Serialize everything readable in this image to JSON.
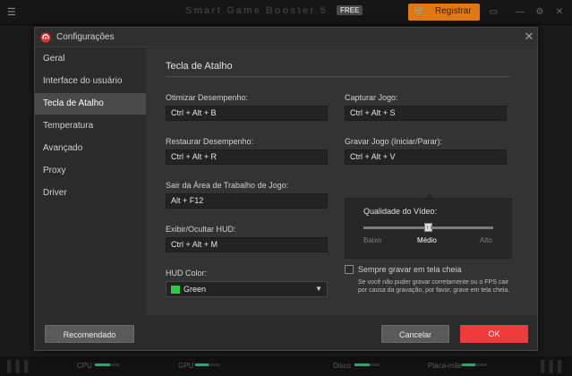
{
  "app": {
    "title": "Smart Game Booster 5",
    "free_badge": "FREE",
    "register_label": "Registrar"
  },
  "status_bar": {
    "cpu_label": "CPU",
    "gpu_label": "GPU",
    "disk_label": "Disco",
    "motherboard_label": "Placa-mãe"
  },
  "dialog": {
    "title": "Configurações",
    "close_glyph": "✕"
  },
  "sidebar": {
    "items": [
      {
        "label": "Geral"
      },
      {
        "label": "Interface do usuário"
      },
      {
        "label": "Tecla de Atalho"
      },
      {
        "label": "Temperatura"
      },
      {
        "label": "Avançado"
      },
      {
        "label": "Proxy"
      },
      {
        "label": "Driver"
      }
    ],
    "active_index": 2
  },
  "hotkeys": {
    "section_title": "Tecla de Atalho",
    "optimize": {
      "label": "Otimizar Desempenho:",
      "value": "Ctrl + Alt + B"
    },
    "restore": {
      "label": "Restaurar Desempenho:",
      "value": "Ctrl + Alt + R"
    },
    "exit_workspace": {
      "label": "Sair da Área de Trabalho de Jogo:",
      "value": "Alt + F12"
    },
    "toggle_hud": {
      "label": "Exibir/Ocultar HUD:",
      "value": "Ctrl + Alt + M"
    },
    "hud_color": {
      "label": "HUD Color:",
      "value": "Green",
      "swatch_color": "#2ecc40"
    },
    "capture": {
      "label": "Capturar Jogo:",
      "value": "Ctrl + Alt + S"
    },
    "record": {
      "label": "Gravar Jogo (Iniciar/Parar):",
      "value": "Ctrl + Alt + V"
    }
  },
  "video_quality": {
    "label": "Qualidade do Vídeo:",
    "options": [
      "Baixo",
      "Médio",
      "Alto"
    ],
    "selected": "Médio"
  },
  "always_record": {
    "label": "Sempre gravar em tela cheia",
    "checked": false,
    "hint": "Se você não puder gravar corretamente ou o FPS cair por causa da gravação, por favor, grave em tela cheia."
  },
  "footer": {
    "recommended_label": "Recomendado",
    "cancel_label": "Cancelar",
    "ok_label": "OK"
  },
  "colors": {
    "accent_ok": "#ef3b3b",
    "register": "#e07a10",
    "active_item": "#4a4a4a"
  }
}
